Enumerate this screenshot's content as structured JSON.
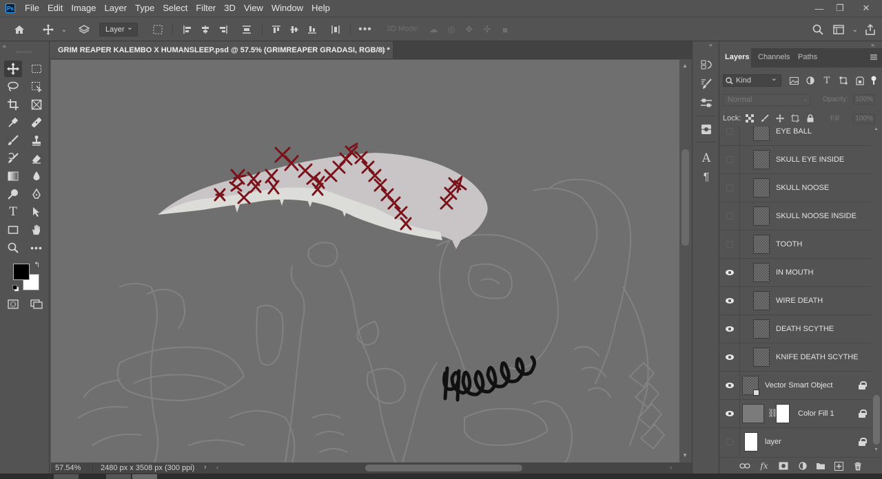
{
  "menubar": {
    "logo": "Ps",
    "items": [
      "File",
      "Edit",
      "Image",
      "Layer",
      "Type",
      "Select",
      "Filter",
      "3D",
      "View",
      "Window",
      "Help"
    ],
    "window_controls": [
      "—",
      "❐",
      "✕"
    ]
  },
  "options": {
    "layer_select": "Layer",
    "mode_3d": "3D Mode:"
  },
  "document": {
    "tab_title": "GRIM REAPER KALEMBO X HUMANSLEEP.psd @ 57.5% (GRIMREAPER GRADASI, RGB/8) *",
    "tab_close": "×",
    "zoom": "57.54%",
    "doc_info": "2480 px x 3508 px (300 ppi)",
    "status_arrow": "›"
  },
  "colors": {
    "canvas_bg": "#6f6f6f",
    "scythe_blade": "#c8c4c6",
    "scythe_edge": "#dcdcda",
    "stitches": "#7a1219",
    "sketch_lines": "#828282",
    "teeth_scribble": "#111111",
    "foreground": "#000000",
    "background": "#ffffff"
  },
  "panel": {
    "tabs": [
      "Layers",
      "Channels",
      "Paths"
    ],
    "active_tab": "Layers",
    "kind": "Kind",
    "blend_mode": "Normal",
    "opacity_label": "Opacity:",
    "opacity_value": "100%",
    "lock_label": "Lock:",
    "fill_label": "Fill:",
    "fill_value": "100%"
  },
  "layers": [
    {
      "name": "EYE BALL",
      "visible": false,
      "thumb": "checker",
      "locked": false
    },
    {
      "name": "SKULL EYE INSIDE",
      "visible": false,
      "thumb": "checker",
      "locked": false
    },
    {
      "name": "SKULL NOOSE",
      "visible": false,
      "thumb": "checker",
      "locked": false
    },
    {
      "name": "SKULL NOOSE INSIDE",
      "visible": false,
      "thumb": "checker",
      "locked": false
    },
    {
      "name": "TOOTH",
      "visible": false,
      "thumb": "checker",
      "locked": false
    },
    {
      "name": "IN MOUTH",
      "visible": true,
      "thumb": "checker",
      "locked": false
    },
    {
      "name": "WIRE DEATH",
      "visible": true,
      "thumb": "checker",
      "locked": false
    },
    {
      "name": "DEATH SCYTHE",
      "visible": true,
      "thumb": "checker",
      "locked": false
    },
    {
      "name": "KNIFE DEATH SCYTHE",
      "visible": true,
      "thumb": "checker",
      "locked": false
    },
    {
      "name": "Vector Smart Object",
      "visible": true,
      "thumb": "smart",
      "locked": true
    },
    {
      "name": "Color Fill 1",
      "visible": true,
      "thumb": "fill",
      "locked": true
    },
    {
      "name": "layer",
      "visible": false,
      "thumb": "white",
      "locked": true
    }
  ]
}
